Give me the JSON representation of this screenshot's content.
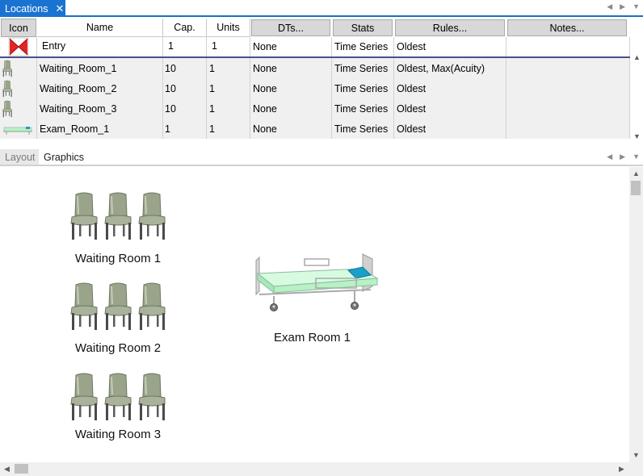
{
  "window_tab": {
    "title": "Locations",
    "close": "✕"
  },
  "grid": {
    "columns": [
      "Icon",
      "Name",
      "Cap.",
      "Units",
      "DTs...",
      "Stats",
      "Rules...",
      "Notes..."
    ],
    "rows": [
      {
        "icon": "entry-icon",
        "name": "Entry",
        "cap": "1",
        "units": "1",
        "dts": "None",
        "stats": "Time Series",
        "rules": "Oldest",
        "notes": ""
      },
      {
        "icon": "chair-icon",
        "name": "Waiting_Room_1",
        "cap": "10",
        "units": "1",
        "dts": "None",
        "stats": "Time Series",
        "rules": "Oldest, Max(Acuity)",
        "notes": ""
      },
      {
        "icon": "chair-icon",
        "name": "Waiting_Room_2",
        "cap": "10",
        "units": "1",
        "dts": "None",
        "stats": "Time Series",
        "rules": "Oldest",
        "notes": ""
      },
      {
        "icon": "chair-icon",
        "name": "Waiting_Room_3",
        "cap": "10",
        "units": "1",
        "dts": "None",
        "stats": "Time Series",
        "rules": "Oldest",
        "notes": ""
      },
      {
        "icon": "bed-icon",
        "name": "Exam_Room_1",
        "cap": "1",
        "units": "1",
        "dts": "None",
        "stats": "Time Series",
        "rules": "Oldest",
        "notes": ""
      }
    ]
  },
  "lower_tabs": {
    "layout": "Layout",
    "graphics": "Graphics"
  },
  "canvas": {
    "waiting_room_1": "Waiting Room 1",
    "waiting_room_2": "Waiting Room 2",
    "waiting_room_3": "Waiting Room 3",
    "exam_room_1": "Exam Room 1"
  },
  "colors": {
    "accent": "#1a73d1",
    "selected_border": "#4b4f8a",
    "bed_sheet": "#b6f2c4",
    "pillow": "#1aa0c8",
    "chair": "#9aa48a"
  }
}
